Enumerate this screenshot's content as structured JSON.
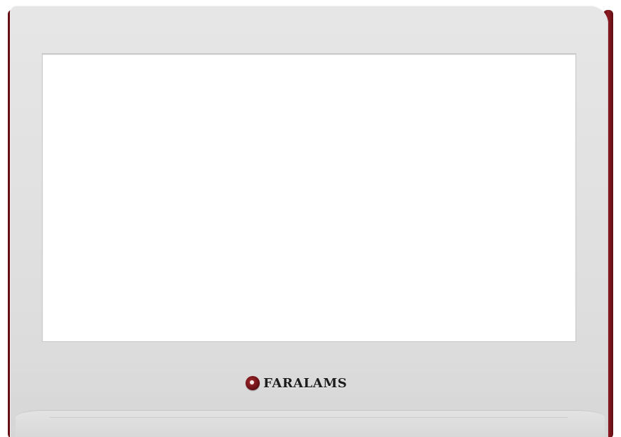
{
  "device": {
    "brand_name": "FARALAMS",
    "logo_icon": "faralams-logo-icon",
    "bezel_color": "#e1e1e1",
    "trim_color": "#7a151c",
    "screen_color": "#ffffff"
  }
}
